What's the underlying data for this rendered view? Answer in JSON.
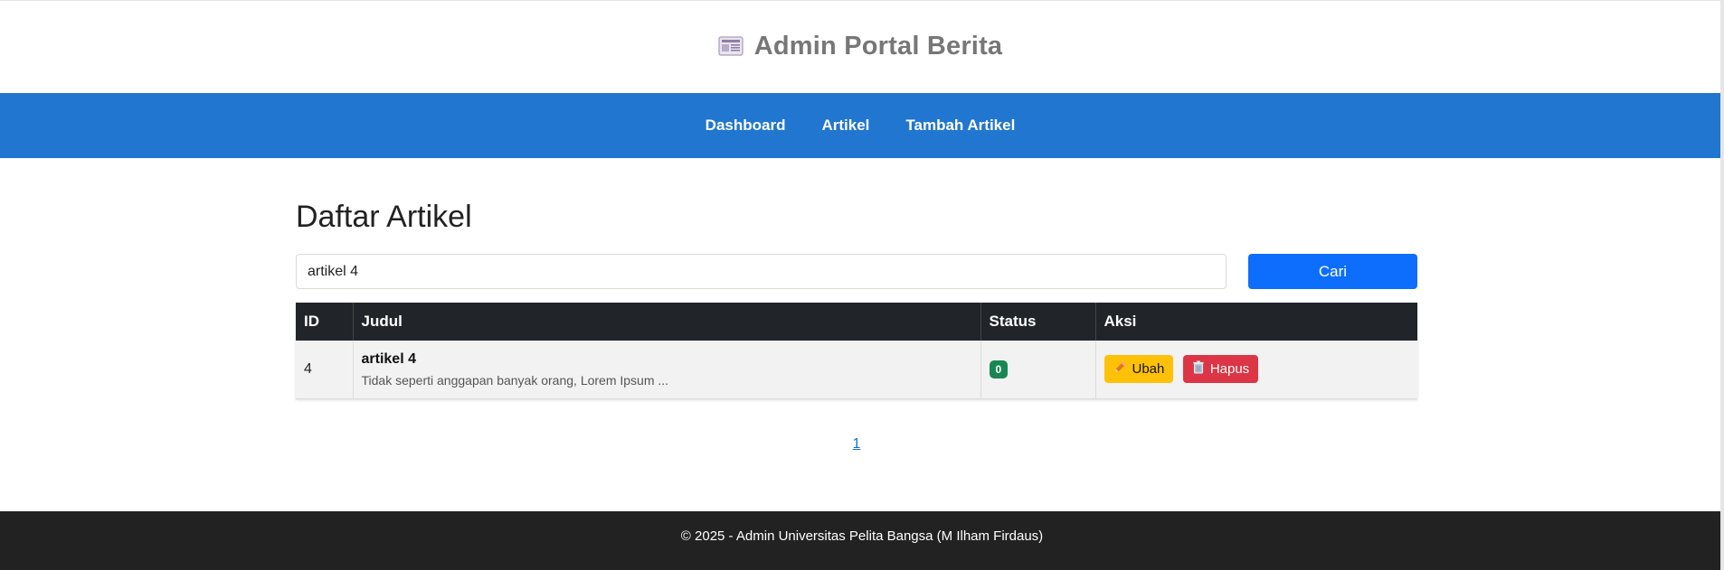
{
  "header": {
    "icon": "newspaper-icon",
    "title": "Admin Portal Berita"
  },
  "nav": {
    "items": [
      {
        "label": "Dashboard"
      },
      {
        "label": "Artikel"
      },
      {
        "label": "Tambah Artikel"
      }
    ]
  },
  "main": {
    "page_title": "Daftar Artikel",
    "search": {
      "value": "artikel 4",
      "button_label": "Cari"
    },
    "table": {
      "headers": [
        "ID",
        "Judul",
        "Status",
        "Aksi"
      ],
      "rows": [
        {
          "id": "4",
          "title": "artikel 4",
          "excerpt": "Tidak seperti anggapan banyak orang, Lorem Ipsum ...",
          "status": "0",
          "edit_label": "Ubah",
          "edit_icon": "pencil-icon",
          "delete_label": "Hapus",
          "delete_icon": "trash-icon"
        }
      ]
    },
    "pagination": {
      "pages": [
        "1"
      ]
    }
  },
  "footer": {
    "text": "© 2025 - Admin Universitas Pelita Bangsa (M Ilham Firdaus)"
  },
  "colors": {
    "navbar": "#2176cf",
    "search_button": "#0d6efd",
    "table_header": "#212529",
    "status_badge": "#198754",
    "edit_button": "#ffc107",
    "delete_button": "#dc3545",
    "footer": "#222222"
  }
}
